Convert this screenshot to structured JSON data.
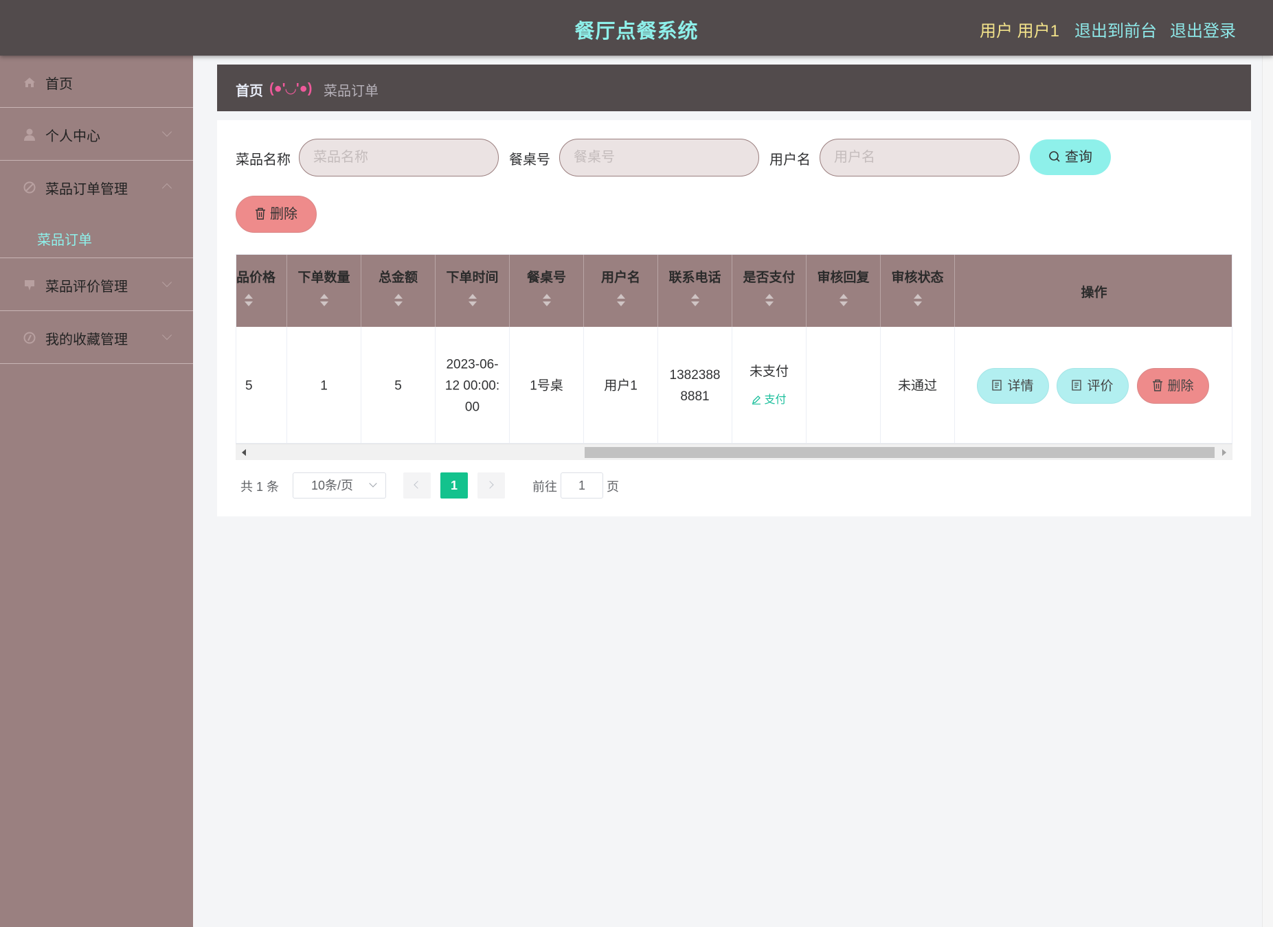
{
  "header": {
    "title": "餐厅点餐系统",
    "user": "用户 用户1",
    "to_front": "退出到前台",
    "logout": "退出登录"
  },
  "sidebar": {
    "items": [
      {
        "label": "首页",
        "icon": "home-icon"
      },
      {
        "label": "个人中心",
        "icon": "user-icon"
      },
      {
        "label": "菜品订单管理",
        "icon": "order-icon",
        "expanded": true,
        "children": [
          {
            "label": "菜品订单",
            "active": true
          }
        ]
      },
      {
        "label": "菜品评价管理",
        "icon": "comment-icon"
      },
      {
        "label": "我的收藏管理",
        "icon": "favorite-icon"
      }
    ]
  },
  "breadcrumb": {
    "home": "首页",
    "separator": "(●'◡'●)",
    "current": "菜品订单"
  },
  "search": {
    "dish_label": "菜品名称",
    "dish_placeholder": "菜品名称",
    "table_label": "餐桌号",
    "table_placeholder": "餐桌号",
    "user_label": "用户名",
    "user_placeholder": "用户名",
    "search_button": "查询",
    "delete_button": "删除"
  },
  "table": {
    "columns": [
      "品价格",
      "下单数量",
      "总金额",
      "下单时间",
      "餐桌号",
      "用户名",
      "联系电话",
      "是否支付",
      "审核回复",
      "审核状态",
      "操作"
    ],
    "rows": [
      {
        "price": "5",
        "quantity": "1",
        "total": "5",
        "order_time": "2023-06-12 00:00:00",
        "table_no": "1号桌",
        "username": "用户1",
        "phone": "13823888881",
        "paid": "未支付",
        "pay_action": "支付",
        "reply": "",
        "status": "未通过",
        "actions": {
          "detail": "详情",
          "rate": "评价",
          "delete": "删除"
        }
      }
    ]
  },
  "pagination": {
    "total": "共 1 条",
    "page_size": "10条/页",
    "current_page": "1",
    "goto_label": "前往",
    "goto_value": "1",
    "page_suffix": "页"
  },
  "colors": {
    "header_bg": "#524b4c",
    "sidebar_bg": "#9a8080",
    "accent_cyan": "#8ef0ea",
    "danger": "#ee8b8b",
    "active_page": "#13c28d"
  }
}
